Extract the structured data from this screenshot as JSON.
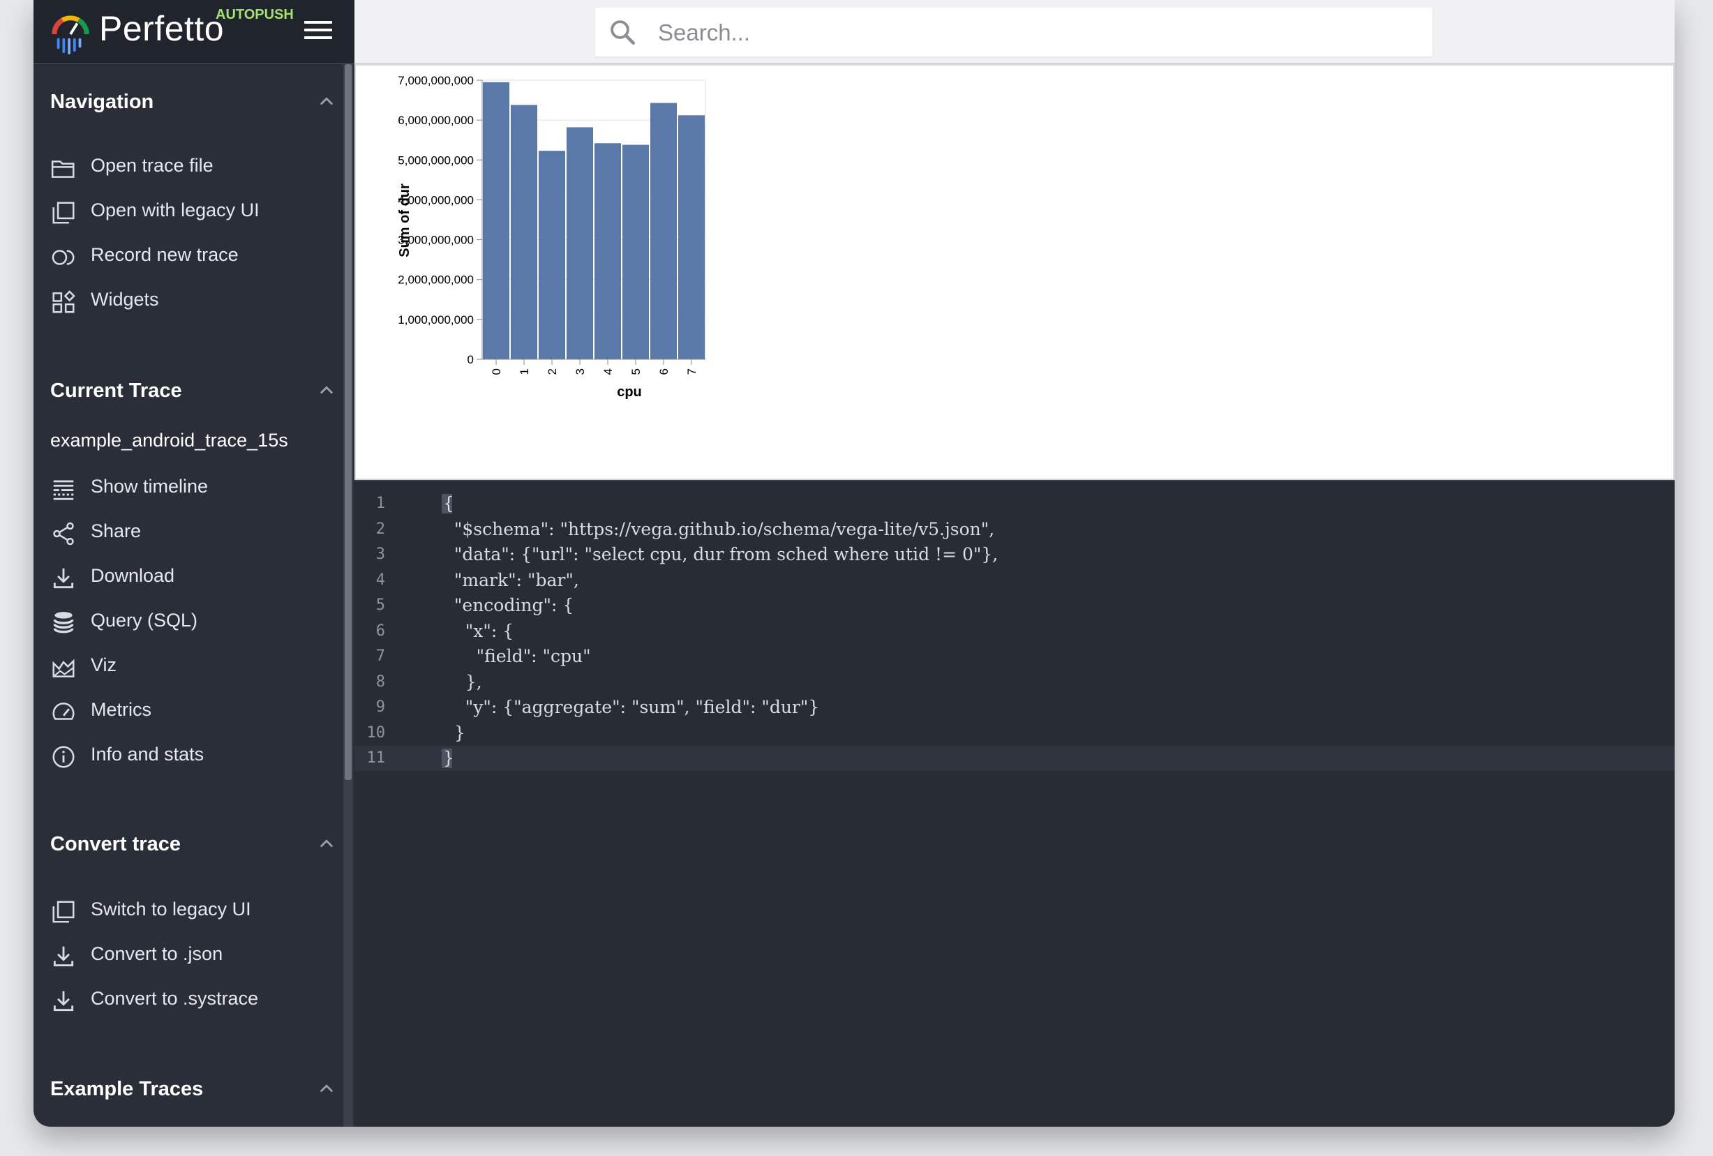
{
  "app": {
    "name": "Perfetto",
    "tag": "AUTOPUSH"
  },
  "sidebar": {
    "sections": [
      {
        "title": "Navigation",
        "items": [
          {
            "label": "Open trace file",
            "icon": "folder-open-icon"
          },
          {
            "label": "Open with legacy UI",
            "icon": "filter-none-icon"
          },
          {
            "label": "Record new trace",
            "icon": "record-icon"
          },
          {
            "label": "Widgets",
            "icon": "widgets-icon"
          }
        ]
      },
      {
        "title": "Current Trace",
        "trace_name": "example_android_trace_15s",
        "items": [
          {
            "label": "Show timeline",
            "icon": "timeline-icon"
          },
          {
            "label": "Share",
            "icon": "share-icon"
          },
          {
            "label": "Download",
            "icon": "download-icon"
          },
          {
            "label": "Query (SQL)",
            "icon": "database-icon"
          },
          {
            "label": "Viz",
            "icon": "area-chart-icon"
          },
          {
            "label": "Metrics",
            "icon": "speed-gauge-icon"
          },
          {
            "label": "Info and stats",
            "icon": "info-icon"
          }
        ]
      },
      {
        "title": "Convert trace",
        "items": [
          {
            "label": "Switch to legacy UI",
            "icon": "filter-none-icon"
          },
          {
            "label": "Convert to .json",
            "icon": "download-icon"
          },
          {
            "label": "Convert to .systrace",
            "icon": "download-icon"
          }
        ]
      },
      {
        "title": "Example Traces",
        "items": []
      }
    ]
  },
  "search": {
    "placeholder": "Search..."
  },
  "chart_data": {
    "type": "bar",
    "title": "",
    "xlabel": "cpu",
    "ylabel": "Sum of dur",
    "categories": [
      "0",
      "1",
      "2",
      "3",
      "4",
      "5",
      "6",
      "7"
    ],
    "values": [
      6950000000,
      6380000000,
      5230000000,
      5820000000,
      5420000000,
      5380000000,
      6430000000,
      6120000000
    ],
    "ylim": [
      0,
      7000000000
    ],
    "yticks": [
      "0",
      "1,000,000,000",
      "2,000,000,000",
      "3,000,000,000",
      "4,000,000,000",
      "5,000,000,000",
      "6,000,000,000",
      "7,000,000,000"
    ],
    "grid": true,
    "bar_color": "#5b79a8"
  },
  "editor": {
    "lines": [
      "{",
      "  \"$schema\": \"https://vega.github.io/schema/vega-lite/v5.json\",",
      "  \"data\": {\"url\": \"select cpu, dur from sched where utid != 0\"},",
      "  \"mark\": \"bar\",",
      "  \"encoding\": {",
      "    \"x\": {",
      "      \"field\": \"cpu\"",
      "    },",
      "    \"y\": {\"aggregate\": \"sum\", \"field\": \"dur\"}",
      "  }",
      "}"
    ],
    "line_numbers": [
      "1",
      "2",
      "3",
      "4",
      "5",
      "6",
      "7",
      "8",
      "9",
      "10",
      "11"
    ],
    "active_line": 11
  },
  "colors": {
    "sidebar_bg": "#2a2e38",
    "editor_bg": "#282c35",
    "accent_tag": "#a6e16b"
  }
}
